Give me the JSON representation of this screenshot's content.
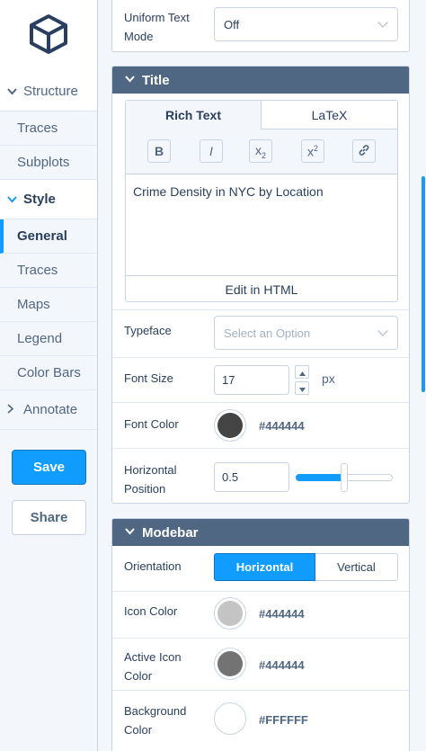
{
  "colors": {
    "accent": "#119dff",
    "header_bg": "#506784",
    "text": "#2a3f5f",
    "muted": "#506784",
    "border": "#c8d4e3"
  },
  "sidebar": {
    "logo_icon": "cube-icon",
    "groups": [
      {
        "label": "Structure",
        "expanded": true,
        "items": [
          {
            "label": "Traces"
          },
          {
            "label": "Subplots"
          }
        ]
      },
      {
        "label": "Style",
        "expanded": true,
        "active": true,
        "items": [
          {
            "label": "General",
            "active": true
          },
          {
            "label": "Traces"
          },
          {
            "label": "Maps"
          },
          {
            "label": "Legend"
          },
          {
            "label": "Color Bars"
          }
        ]
      },
      {
        "label": "Annotate",
        "expanded": false
      }
    ],
    "save_label": "Save",
    "share_label": "Share"
  },
  "main": {
    "uniform_text": {
      "label": "Uniform Text Mode",
      "value": "Off"
    },
    "title_panel": {
      "header": "Title",
      "tabs": [
        "Rich Text",
        "LaTeX"
      ],
      "active_tab": "Rich Text",
      "toolbar": {
        "bold": "B",
        "italic": "I",
        "subscript": "x",
        "subscript_sub": "2",
        "superscript": "x",
        "superscript_sup": "2"
      },
      "text_value": "Crime Density in NYC by Location",
      "edit_html_label": "Edit in HTML",
      "typeface": {
        "label": "Typeface",
        "placeholder": "Select an Option"
      },
      "font_size": {
        "label": "Font Size",
        "value": "17",
        "unit": "px"
      },
      "font_color": {
        "label": "Font Color",
        "hex": "#444444",
        "swatch": "#444444"
      },
      "horizontal_position": {
        "label": "Horizontal Position",
        "value": "0.5",
        "slider_fraction": 0.5
      }
    },
    "modebar_panel": {
      "header": "Modebar",
      "orientation": {
        "label": "Orientation",
        "options": [
          "Horizontal",
          "Vertical"
        ],
        "selected": "Horizontal"
      },
      "icon_color": {
        "label": "Icon Color",
        "hex": "#444444",
        "swatch": "#c4c4c4"
      },
      "active_icon_color": {
        "label": "Active Icon Color",
        "hex": "#444444",
        "swatch": "#737373"
      },
      "background_color": {
        "label": "Background Color",
        "hex": "#FFFFFF",
        "swatch": "#ffffff"
      }
    }
  }
}
